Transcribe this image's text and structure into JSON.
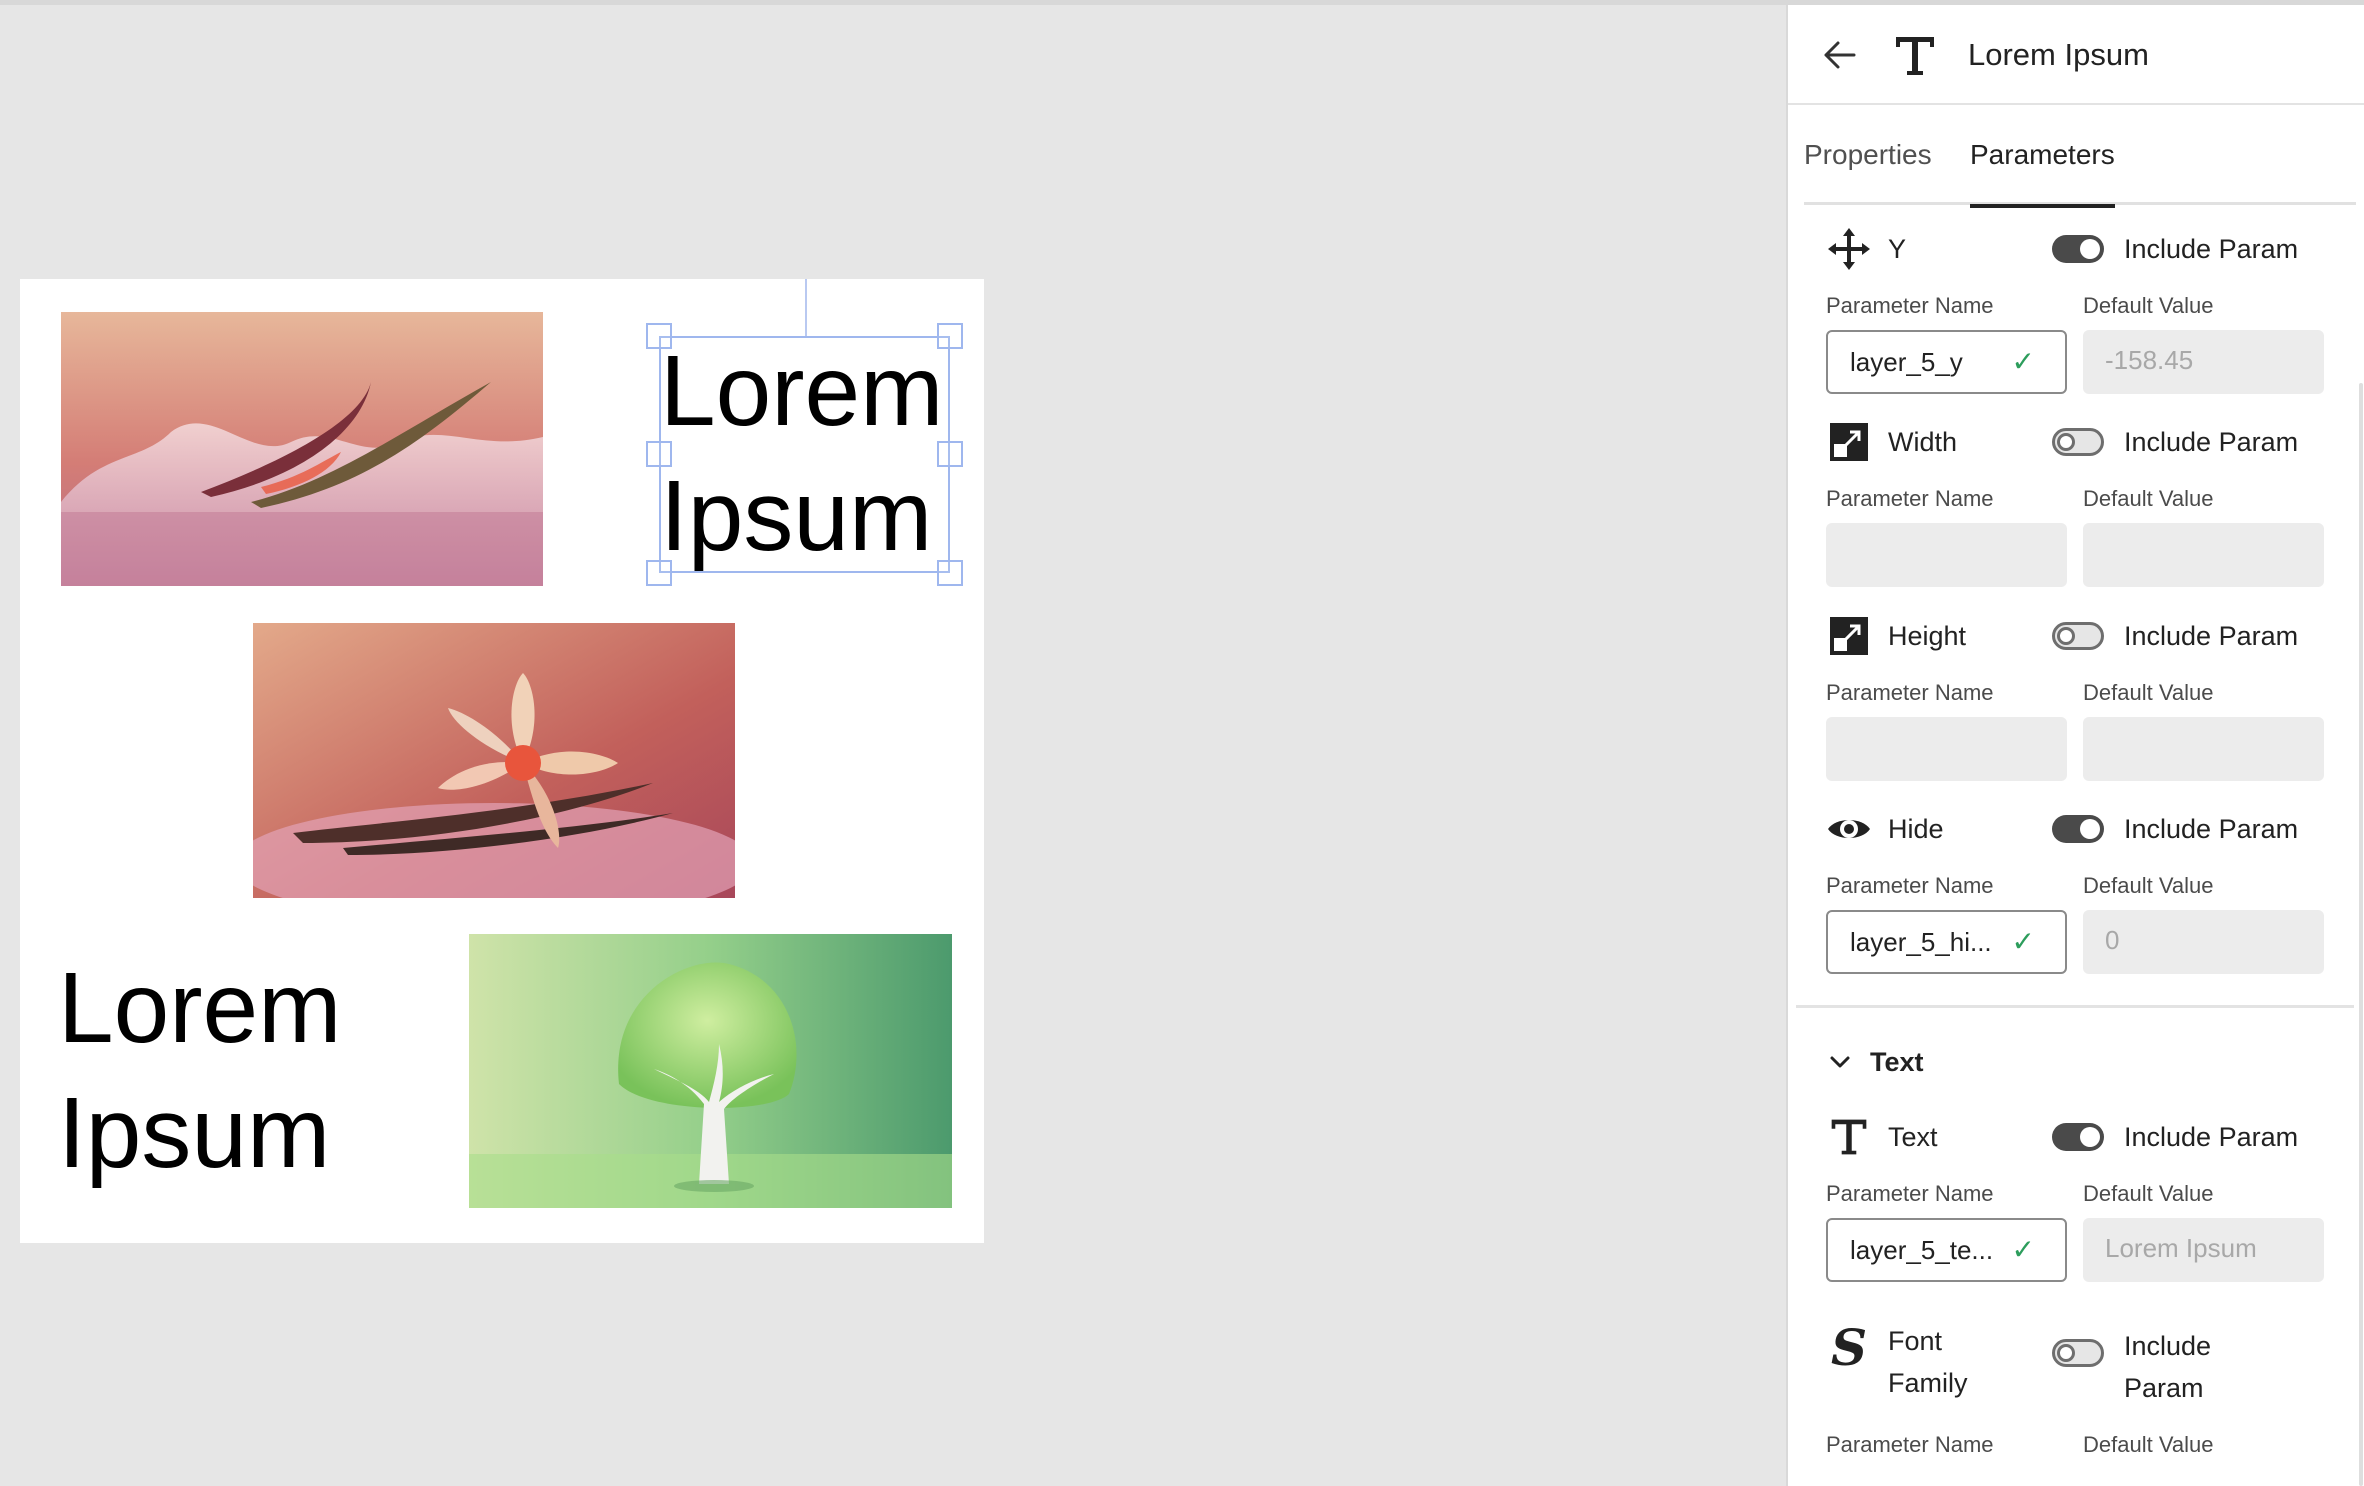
{
  "canvas": {
    "text_a": [
      "Lorem",
      "Ipsum"
    ],
    "text_b": [
      "Lorem",
      "Ipsum"
    ],
    "images": [
      "vanilla-pods",
      "vanilla-flower",
      "tree"
    ]
  },
  "panel": {
    "header": {
      "title": "Lorem Ipsum",
      "back_icon": "arrow-left-icon",
      "type_icon": "text-type-icon"
    },
    "tabs": [
      {
        "label": "Properties",
        "active": false
      },
      {
        "label": "Parameters",
        "active": true
      }
    ],
    "params": [
      {
        "icon": "move-icon",
        "label": "Y",
        "include_label": "Include Param",
        "include": true,
        "name_label": "Parameter Name",
        "default_label": "Default Value",
        "name_value": "layer_5_y",
        "default_value": "-158.45",
        "valid": true
      },
      {
        "icon": "resize-icon",
        "label": "Width",
        "include_label": "Include Param",
        "include": false,
        "name_label": "Parameter Name",
        "default_label": "Default Value",
        "name_value": "",
        "default_value": "",
        "valid": false
      },
      {
        "icon": "resize-icon",
        "label": "Height",
        "include_label": "Include Param",
        "include": false,
        "name_label": "Parameter Name",
        "default_label": "Default Value",
        "name_value": "",
        "default_value": "",
        "valid": false
      },
      {
        "icon": "eye-icon",
        "label": "Hide",
        "include_label": "Include Param",
        "include": true,
        "name_label": "Parameter Name",
        "default_label": "Default Value",
        "name_value": "layer_5_hi...",
        "default_value": "0",
        "valid": true
      }
    ],
    "text_section": {
      "title": "Text",
      "params": [
        {
          "icon": "text-type-icon",
          "label": "Text",
          "include_label": "Include Param",
          "include": true,
          "name_label": "Parameter Name",
          "default_label": "Default Value",
          "name_value": "layer_5_te...",
          "default_value": "Lorem Ipsum",
          "valid": true
        },
        {
          "icon": "font-family-icon",
          "label_lines": [
            "Font",
            "Family"
          ],
          "include_label_lines": [
            "Include",
            "Param"
          ],
          "include": false,
          "name_label": "Parameter Name",
          "default_label": "Default Value"
        }
      ]
    },
    "colors": {
      "toggle_on": "#4a4a4a",
      "check": "#2d9d5c",
      "selection": "#9fb7ee"
    }
  }
}
